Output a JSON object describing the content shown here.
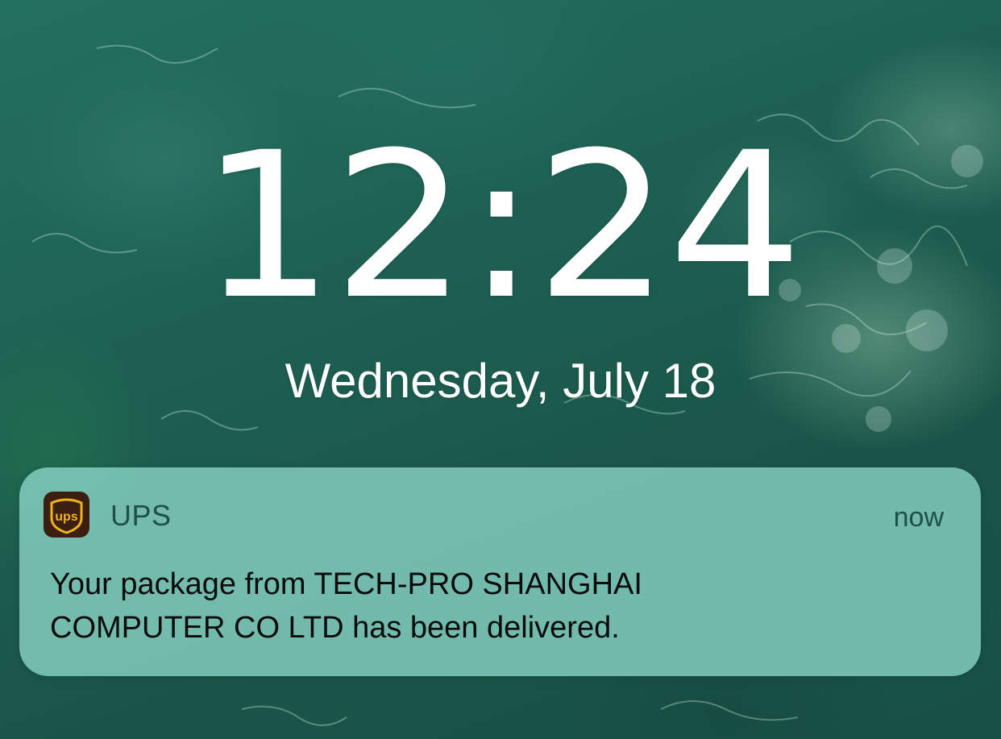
{
  "lock_screen": {
    "time": "12:24",
    "date": "Wednesday, July 18"
  },
  "notification": {
    "app_icon": "ups-logo-icon",
    "app_icon_text": "ups",
    "app_name": "UPS",
    "time": "now",
    "body_line1": "Your package from TECH-PRO  SHANGHAI",
    "body_line2": "COMPUTER CO LTD has been delivered."
  },
  "colors": {
    "notification_bg": "#8cd7c8",
    "app_icon_brown": "#3b1f10",
    "app_icon_gold": "#f2b21c",
    "text_dark": "#0b0b0b",
    "header_text": "#1f4f45",
    "wallpaper_base": "#1f5a4c"
  }
}
